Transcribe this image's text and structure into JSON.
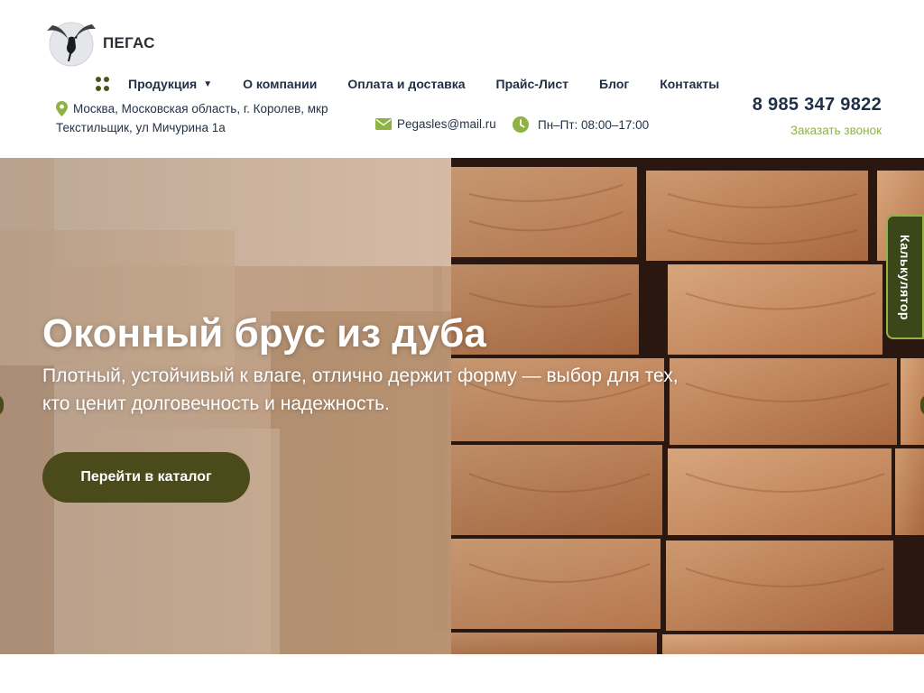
{
  "brand": {
    "name": "ПЕГАС"
  },
  "nav": {
    "items": [
      {
        "label": "Продукция",
        "has_dropdown": true
      },
      {
        "label": "О компании"
      },
      {
        "label": "Оплата и доставка"
      },
      {
        "label": "Прайс-Лист"
      },
      {
        "label": "Блог"
      },
      {
        "label": "Контакты"
      }
    ]
  },
  "contacts": {
    "address_line1": "Москва, Московская область, г. Королев, мкр",
    "address_line2": "Текстильщик, ул Мичурина 1а",
    "email": "Pegasles@mail.ru",
    "hours": "Пн–Пт: 08:00–17:00",
    "phone": "8 985 347 9822",
    "callback_label": "Заказать звонок"
  },
  "hero": {
    "title": "Оконный брус из дуба",
    "subtitle": "Плотный, устойчивый к влаге, отлично держит форму — выбор для тех, кто ценит долговечность и надежность.",
    "button_label": "Перейти в каталог"
  },
  "side_tab": {
    "label": "Калькулятор"
  },
  "colors": {
    "accent": "#8fb343",
    "dark_olive": "#4a4a1b",
    "nav_text": "#1f2f45",
    "calc_tab": "#3b4718"
  },
  "icons": {
    "logo": "pegasus-logo",
    "menu": "grid-dots-icon",
    "address": "map-pin-icon",
    "email": "envelope-icon",
    "hours": "clock-icon"
  }
}
